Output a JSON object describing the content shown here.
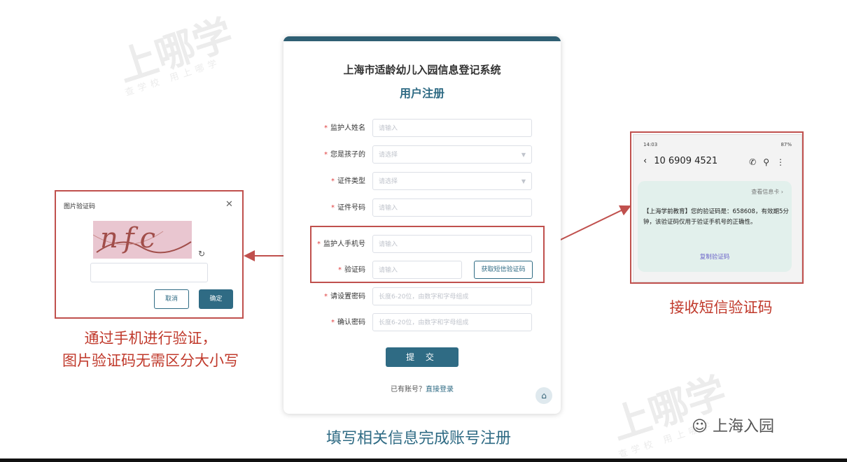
{
  "watermarks": {
    "brand": "上哪学",
    "slogan": "查学校 用上哪学"
  },
  "form": {
    "system_title": "上海市适龄幼儿入园信息登记系统",
    "register_title": "用户注册",
    "fields": [
      {
        "label": "监护人姓名",
        "placeholder": "请输入"
      },
      {
        "label": "您是孩子的",
        "placeholder": "请选择"
      },
      {
        "label": "证件类型",
        "placeholder": "请选择"
      },
      {
        "label": "证件号码",
        "placeholder": "请输入"
      },
      {
        "label": "监护人手机号",
        "placeholder": "请输入"
      },
      {
        "label": "验证码",
        "placeholder": "请输入"
      },
      {
        "label": "请设置密码",
        "placeholder": "长度6-20位，由数字和字母组成"
      },
      {
        "label": "确认密码",
        "placeholder": "长度6-20位，由数字和字母组成"
      }
    ],
    "sms_button": "获取短信验证码",
    "submit": "提 交",
    "has_account": "已有账号？",
    "login_link": "直接登录"
  },
  "captcha_dialog": {
    "title": "图片验证码",
    "captcha_text": "nfc",
    "cancel": "取消",
    "confirm": "确定"
  },
  "sms": {
    "time": "14:03",
    "battery": "87%",
    "sender": "10 6909 4521",
    "view_card": "查看信息卡",
    "body": "【上海学前教育】您的验证码是：658608，有效期5分钟，该验证码仅用于验证手机号的正确性。",
    "copy": "复制验证码"
  },
  "captions": {
    "left_line1": "通过手机进行验证，",
    "left_line2": "图片验证码无需区分大小写",
    "right": "接收短信验证码",
    "bottom": "填写相关信息完成账号注册",
    "wechat": "上海入园"
  },
  "colors": {
    "primary": "#2f6b84",
    "highlight": "#c0504d",
    "caption_red": "#c0392b"
  }
}
